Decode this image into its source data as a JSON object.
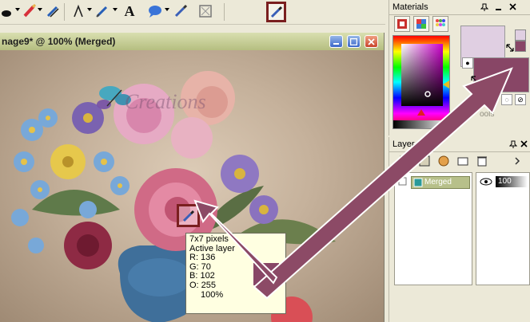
{
  "document": {
    "title": "nage9* @ 100% (Merged)",
    "watermark": "Creations"
  },
  "toolbar": {
    "icons": [
      "brush-icon",
      "paint-brush-icon",
      "clone-brush-icon",
      "pen-icon",
      "text-icon",
      "balloon-icon",
      "dropper-icon",
      "picture-tube-icon",
      "dropper-icon"
    ]
  },
  "info_popup": {
    "line1": "7x7 pixels",
    "line2": "Active layer",
    "r": "R: 136",
    "g": "G: 70",
    "b": "B: 102",
    "o": "O: 255",
    "zoom": "100%"
  },
  "picked_color": "#884666",
  "materials": {
    "title": "Materials",
    "foreground_color": "#e0cfe2",
    "background_color": "#884666",
    "all_tools_label": "ools"
  },
  "layers": {
    "title": "Layer",
    "layer_name": "Merged",
    "opacity": "100"
  }
}
